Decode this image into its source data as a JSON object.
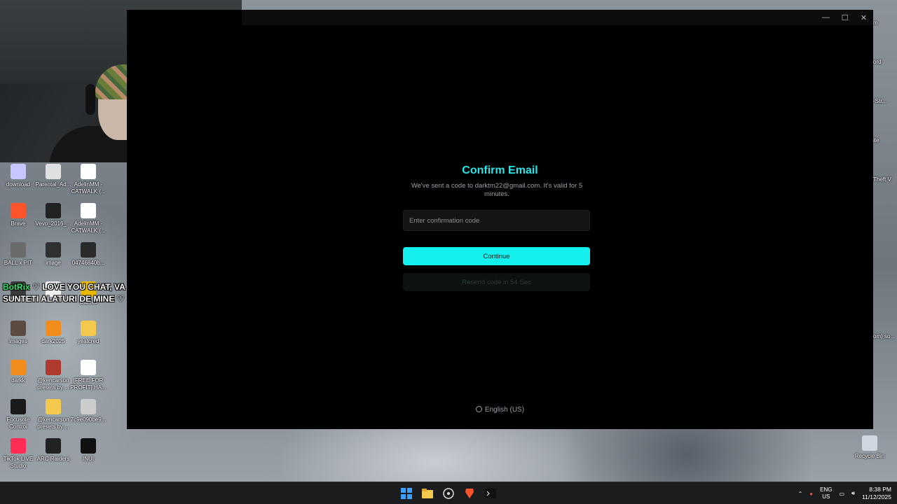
{
  "dialog": {
    "title": "Confirm Email",
    "description": "We've sent a code to darktm22@gmail.com. It's valid for 5 minutes.",
    "code_placeholder": "Enter confirmation code",
    "continue_label": "Continue",
    "resend_label": "Resend code in 54 Sec",
    "language": "English (US)"
  },
  "window_controls": {
    "minimize": "—",
    "maximize": "☐",
    "close": "✕"
  },
  "chat": {
    "user": "BotRix",
    "message": "LOVE YOU CHAT, VA MULTUMESC CA SUNTETI ALATURI DE MINE"
  },
  "desktop_icons": [
    {
      "label": "download",
      "color": "#c7c7ff"
    },
    {
      "label": "Parental_Ad...",
      "color": "#e0e0e0"
    },
    {
      "label": "AdelinMM - CATWALK (...",
      "color": "#ffffff"
    },
    {
      "label": "Brave",
      "color": "#fb542b"
    },
    {
      "label": "Vevo_2016_...",
      "color": "#222222"
    },
    {
      "label": "AdelinMM - CATWALK (...",
      "color": "#ffffff"
    },
    {
      "label": "BALL x PIT",
      "color": "#6b6b6b"
    },
    {
      "label": "image",
      "color": "#303030"
    },
    {
      "label": "04746840b...",
      "color": "#2a2a2a"
    },
    {
      "label": "",
      "color": "#3a3a3a"
    },
    {
      "label": "",
      "color": "#eeeeee"
    },
    {
      "label": "Games",
      "color": "#e6b800"
    },
    {
      "label": "images",
      "color": "#5a4a40"
    },
    {
      "label": "dark2025",
      "color": "#f28c1a"
    },
    {
      "label": "yeatcred",
      "color": "#f2c94c"
    },
    {
      "label": "darkk",
      "color": "#f28c1a"
    },
    {
      "label": "@kencarson presets by ...",
      "color": "#b03a2e"
    },
    {
      "label": "[FREE FOR PROFIT] HA...",
      "color": "#ffffff"
    },
    {
      "label": "Focusrite Control",
      "color": "#1a1a1a"
    },
    {
      "label": "@kencarson presets by ...",
      "color": "#f2c94c"
    },
    {
      "label": "7c9e090be9...",
      "color": "#cccccc"
    },
    {
      "label": "TikTok LIVE Studio",
      "color": "#ff2d55"
    },
    {
      "label": "ARC Raiders",
      "color": "#222222"
    },
    {
      "label": "INUI",
      "color": "#111111"
    }
  ],
  "right_icons": [
    {
      "label": "m"
    },
    {
      "label": "ord"
    },
    {
      "label": "-Str..."
    },
    {
      "label": "ite"
    },
    {
      "label": "Theft V"
    },
    {
      "label": "om) so..."
    }
  ],
  "recycle_bin": "Recycle Bin",
  "taskbar": {
    "lang_top": "ENG",
    "lang_bottom": "US",
    "time": "8:38 PM",
    "date": "11/12/2025"
  }
}
